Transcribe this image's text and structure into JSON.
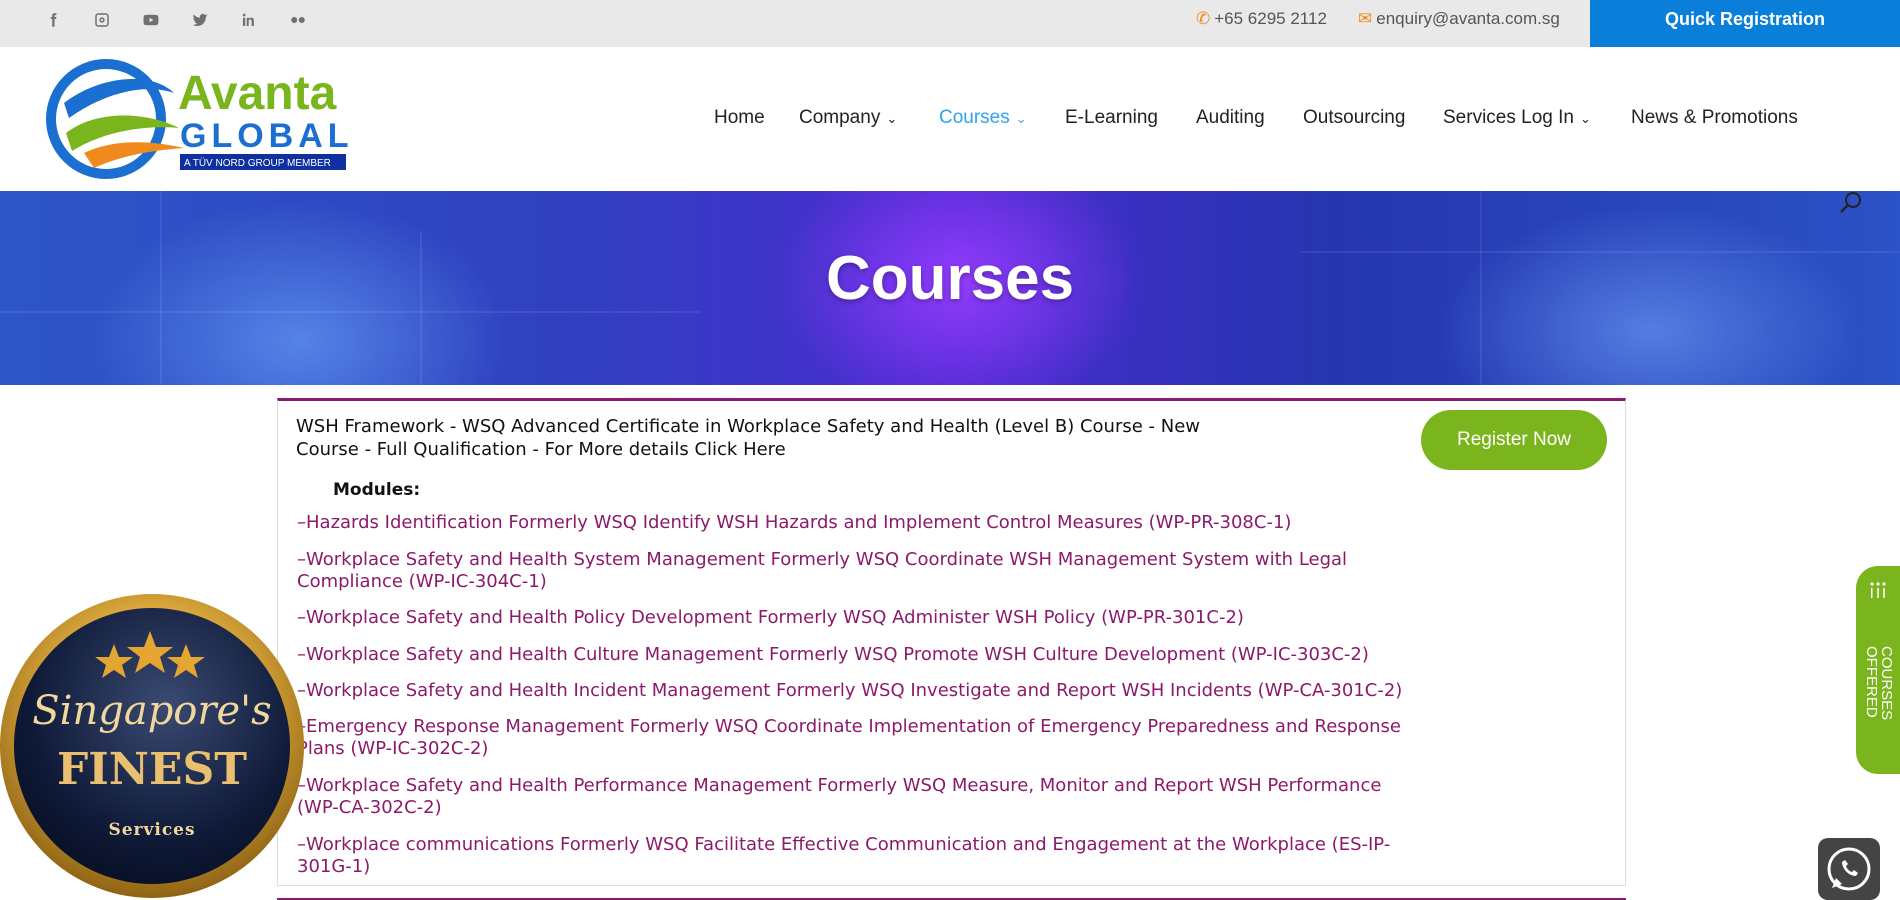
{
  "topbar": {
    "social_icons": [
      "facebook-icon",
      "instagram-icon",
      "youtube-icon",
      "twitter-icon",
      "linkedin-icon",
      "flickr-icon"
    ],
    "phone": "+65 6295 2112",
    "email": "enquiry@avanta.com.sg",
    "quick_registration": "Quick Registration"
  },
  "logo": {
    "word1": "Avanta",
    "word2": "GLOBAL",
    "tagline": "A TÜV NORD GROUP MEMBER"
  },
  "nav": {
    "items": [
      {
        "label": "Home"
      },
      {
        "label": "Company"
      },
      {
        "label": "Courses"
      },
      {
        "label": "E-Learning"
      },
      {
        "label": "Auditing"
      },
      {
        "label": "Outsourcing"
      },
      {
        "label": "Services Log In"
      },
      {
        "label": "News & Promotions"
      }
    ],
    "active": "Courses"
  },
  "hero": {
    "title": "Courses"
  },
  "course": {
    "title": "WSH Framework - WSQ Advanced Certificate in Workplace Safety and Health (Level B) Course - New Course - Full Qualification - For More details Click Here",
    "register_label": "Register Now",
    "modules_label": "Modules:",
    "modules": [
      "–Hazards Identification Formerly WSQ Identify WSH Hazards and Implement Control Measures (WP-PR-308C-1)",
      "–Workplace Safety and Health System Management Formerly WSQ Coordinate WSH Management System with Legal Compliance (WP-IC-304C-1)",
      "–Workplace Safety and Health Policy Development Formerly WSQ Administer WSH Policy (WP-PR-301C-2)",
      "–Workplace Safety and Health Culture Management Formerly WSQ Promote WSH Culture Development (WP-IC-303C-2)",
      "–Workplace Safety and Health Incident Management Formerly WSQ Investigate and Report WSH Incidents (WP-CA-301C-2)",
      "–Emergency Response Management Formerly WSQ Coordinate Implementation of Emergency Preparedness and Response Plans (WP-IC-302C-2)",
      "–Workplace Safety and Health Performance Management Formerly WSQ Measure, Monitor and Report WSH Performance (WP-CA-302C-2)",
      "–Workplace communications Formerly WSQ Facilitate Effective Communication and Engagement at the Workplace (ES-IP-301G-1)"
    ]
  },
  "badge": {
    "line1": "Singapore's",
    "line2": "FINEST",
    "line3": "Services"
  },
  "sidetab": {
    "label": "COURSES OFFERED"
  },
  "colors": {
    "accent_blue": "#0a7fd9",
    "nav_active": "#2ea3f2",
    "brand_green": "#7ab51d",
    "module_link": "#8c1a6a"
  }
}
